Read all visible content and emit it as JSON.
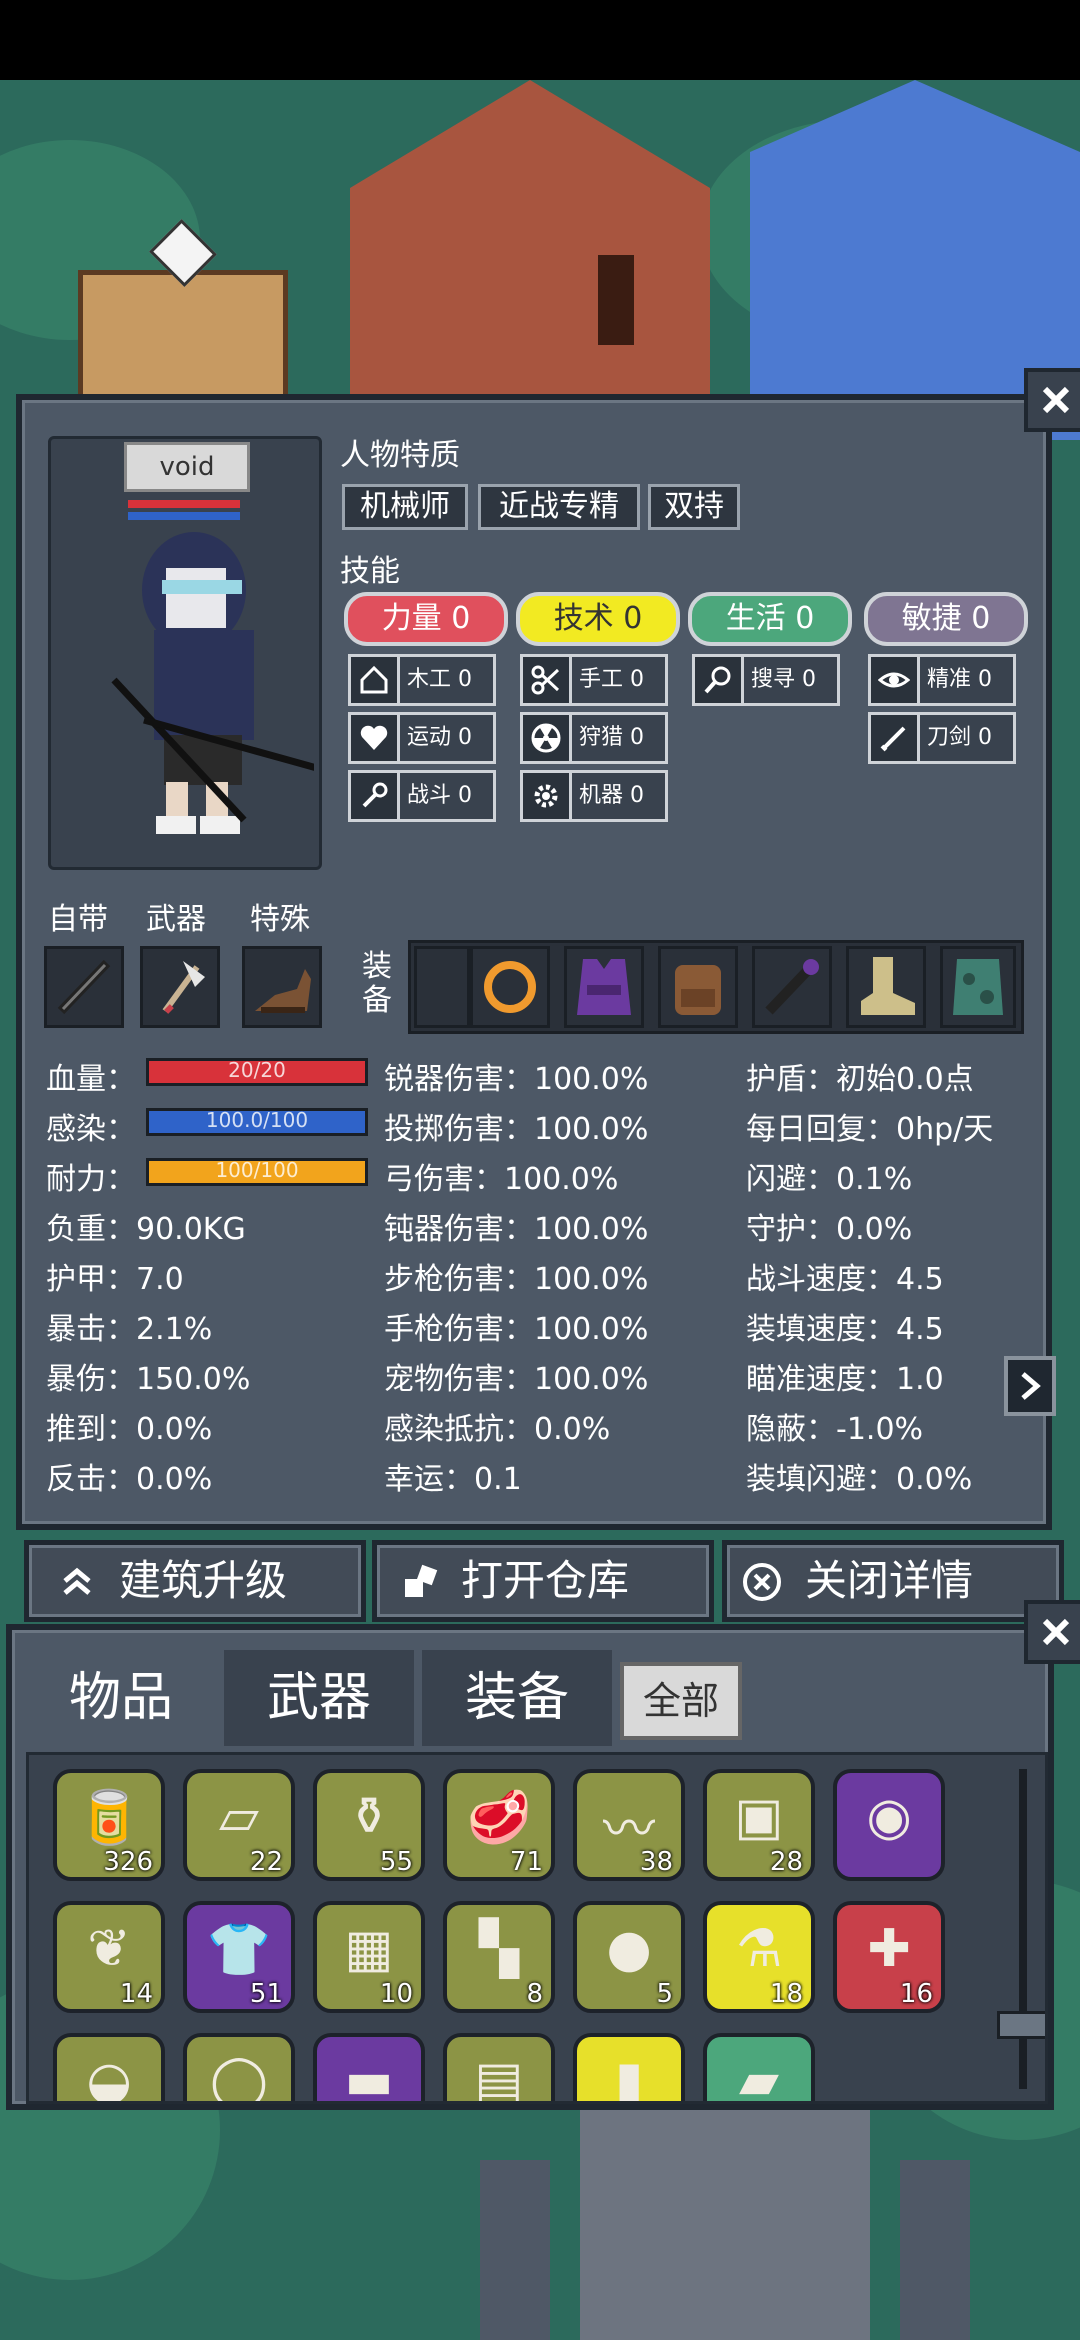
{
  "character": {
    "name": "void"
  },
  "traits_title": "人物特质",
  "traits": [
    "机械师",
    "近战专精",
    "双持"
  ],
  "skills_title": "技能",
  "skill_groups": [
    {
      "label": "力量 0",
      "color": "#e0505d",
      "text": "#ffffff"
    },
    {
      "label": "技术 0",
      "color": "#f2ea22",
      "text": "#333333"
    },
    {
      "label": "生活 0",
      "color": "#4ca77c",
      "text": "#ffffff"
    },
    {
      "label": "敏捷 0",
      "color": "#7f7592",
      "text": "#ffffff"
    }
  ],
  "skills": [
    {
      "label": "木工 0",
      "icon": "house-icon"
    },
    {
      "label": "手工 0",
      "icon": "scissors-icon"
    },
    {
      "label": "搜寻 0",
      "icon": "magnifier-icon"
    },
    {
      "label": "精准 0",
      "icon": "eye-icon"
    },
    {
      "label": "运动 0",
      "icon": "heart-icon"
    },
    {
      "label": "狩猎 0",
      "icon": "radiation-icon"
    },
    {
      "label": "刀剑 0",
      "icon": "blade-icon"
    },
    {
      "label": "战斗 0",
      "icon": "wrench-icon"
    },
    {
      "label": "机器 0",
      "icon": "gear-icon"
    }
  ],
  "slot_labels": {
    "innate": "自带",
    "weapon": "武器",
    "special": "特殊",
    "equip": "装备"
  },
  "stats_left": [
    {
      "label": "血量："
    },
    {
      "label": "感染："
    },
    {
      "label": "耐力："
    },
    {
      "label": "负重：",
      "value": "90.0KG"
    },
    {
      "label": "护甲：",
      "value": "7.0"
    },
    {
      "label": "暴击：",
      "value": "2.1%"
    },
    {
      "label": "暴伤：",
      "value": "150.0%"
    },
    {
      "label": "推到：",
      "value": "0.0%"
    },
    {
      "label": "反击：",
      "value": "0.0%"
    }
  ],
  "bars": [
    {
      "text": "20/20",
      "fraction": 1.0,
      "color": "#d8323a"
    },
    {
      "text": "100.0/100",
      "fraction": 1.0,
      "color": "#2f63c9"
    },
    {
      "text": "100/100",
      "fraction": 1.0,
      "color": "#f2a41c"
    }
  ],
  "stats_mid": [
    "锐器伤害：100.0%",
    "投掷伤害：100.0%",
    "弓伤害：100.0%",
    "钝器伤害：100.0%",
    "步枪伤害：100.0%",
    "手枪伤害：100.0%",
    "宠物伤害：100.0%",
    "感染抵抗：0.0%",
    "幸运：0.1"
  ],
  "stats_right": [
    "护盾：初始0.0点",
    "每日回复：0hp/天",
    "闪避：0.1%",
    "守护：0.0%",
    "战斗速度：4.5",
    "装填速度：4.5",
    "瞄准速度：1.0",
    "隐蔽：-1.0%",
    "装填闪避：0.0%"
  ],
  "actions": {
    "upgrade": "建筑升级",
    "storage": "打开仓库",
    "close": "关闭详情"
  },
  "inventory": {
    "tabs": [
      "物品",
      "武器",
      "装备"
    ],
    "filter": "全部",
    "items": [
      {
        "count": "326",
        "icon": "food-supplies-icon",
        "bg": "#8c9445"
      },
      {
        "count": "22",
        "icon": "cloth-icon",
        "bg": "#8c9445"
      },
      {
        "count": "55",
        "icon": "jar-icon",
        "bg": "#8c9445"
      },
      {
        "count": "71",
        "icon": "meat-icon",
        "bg": "#8c9445"
      },
      {
        "count": "38",
        "icon": "rope-icon",
        "bg": "#8c9445"
      },
      {
        "count": "28",
        "icon": "canned-meat-icon",
        "bg": "#8c9445"
      },
      {
        "count": "",
        "icon": "battery-icon",
        "bg": "#6b3aa0"
      },
      {
        "count": "14",
        "icon": "herb-icon",
        "bg": "#8c9445"
      },
      {
        "count": "51",
        "icon": "shirt-icon",
        "bg": "#6b3aa0"
      },
      {
        "count": "10",
        "icon": "chocolate-icon",
        "bg": "#8c9445"
      },
      {
        "count": "8",
        "icon": "socks-icon",
        "bg": "#8c9445"
      },
      {
        "count": "5",
        "icon": "apple-icon",
        "bg": "#8c9445"
      },
      {
        "count": "18",
        "icon": "potion-icon",
        "bg": "#e7e02a"
      },
      {
        "count": "16",
        "icon": "medkit-icon",
        "bg": "#c8404a"
      },
      {
        "count": "",
        "icon": "shell-icon",
        "bg": "#8c9445"
      },
      {
        "count": "",
        "icon": "egg-icon",
        "bg": "#8c9445"
      },
      {
        "count": "",
        "icon": "tube-icon",
        "bg": "#6b3aa0"
      },
      {
        "count": "",
        "icon": "circuit-icon",
        "bg": "#8c9445"
      },
      {
        "count": "",
        "icon": "bottle-icon",
        "bg": "#e7e02a"
      },
      {
        "count": "",
        "icon": "wood-log-icon",
        "bg": "#4ca77c"
      }
    ]
  }
}
